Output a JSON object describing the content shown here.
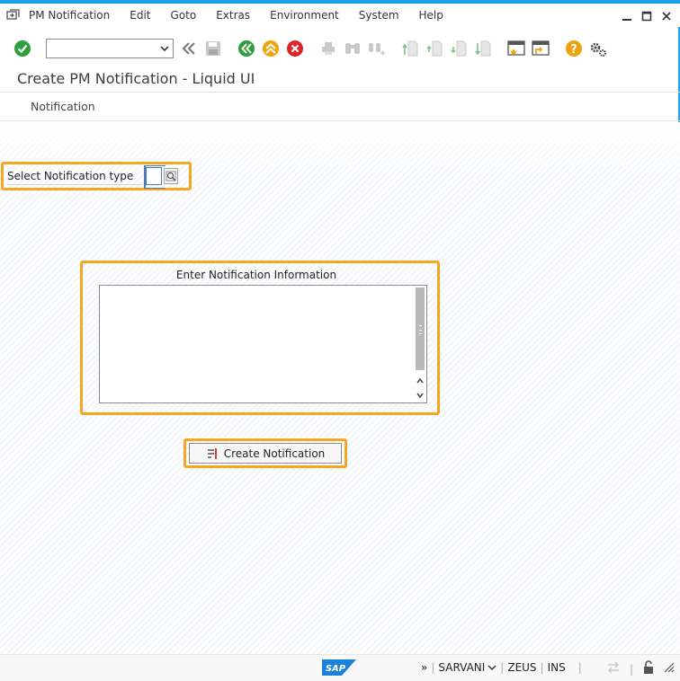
{
  "menu": {
    "items": [
      "PM Notification",
      "Edit",
      "Goto",
      "Extras",
      "Environment",
      "System",
      "Help"
    ]
  },
  "toolbar": {
    "command_value": ""
  },
  "title": "Create PM Notification - Liquid UI",
  "app_toolbar": {
    "tab_label": "Notification"
  },
  "form": {
    "select_label": "Select Notification type",
    "type_value": "",
    "group_title": "Enter Notification Information",
    "notification_text": "",
    "create_button_label": "Create Notification"
  },
  "status": {
    "user": "SARVANI",
    "system": "ZEUS",
    "mode": "INS",
    "logo_text": "SAP"
  },
  "colors": {
    "highlight": "#f5a623",
    "accent": "#1ea0e6",
    "green": "#2e9e3e",
    "orange": "#f0a30a",
    "red": "#d9262c"
  }
}
